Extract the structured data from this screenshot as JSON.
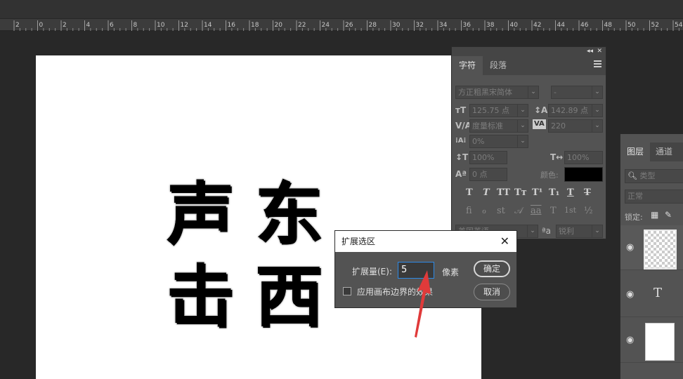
{
  "ruler": {
    "ticks": [
      "2",
      "0",
      "2",
      "4",
      "6",
      "8",
      "10",
      "12",
      "14",
      "16",
      "18",
      "20",
      "22",
      "24",
      "26",
      "28",
      "30",
      "32",
      "34",
      "36",
      "38",
      "40",
      "42",
      "44",
      "46",
      "48",
      "50",
      "52",
      "54"
    ]
  },
  "canvas": {
    "glyphs": [
      "声",
      "东",
      "击",
      "西"
    ]
  },
  "character_panel": {
    "tabs": [
      "字符",
      "段落"
    ],
    "font_family": "方正粗黑宋简体",
    "font_style": "-",
    "font_size": "125.75 点",
    "leading": "142.89 点",
    "kerning": "度量标准",
    "tracking": "220",
    "tsume": "0%",
    "vertical_scale": "100%",
    "horizontal_scale": "100%",
    "baseline_shift": "0 点",
    "color_label": "颜色:",
    "color_value": "#000000",
    "style_buttons": [
      "T",
      "T",
      "TT",
      "Tт",
      "T¹",
      "T₁",
      "T",
      "T"
    ],
    "opentype_buttons": [
      "fi",
      "ℴ",
      "st",
      "𝒜",
      "aa",
      "T",
      "1st",
      "½"
    ],
    "language": "美国英语",
    "aa_label": "ªa",
    "antialias": "锐利"
  },
  "layers_panel": {
    "tabs": [
      "图层",
      "通道"
    ],
    "search_placeholder": "类型",
    "blend_mode": "正常",
    "lock_label": "锁定:",
    "layer_text_glyph": "T"
  },
  "dialog": {
    "title": "扩展选区",
    "expand_label": "扩展量(E):",
    "expand_value": "5",
    "unit": "像素",
    "checkbox_label": "应用画布边界的效果",
    "ok_label": "确定",
    "cancel_label": "取消",
    "close_glyph": "✕"
  },
  "colors": {
    "accent_blue": "#2e8ae6",
    "annotation_red": "#e03a3a"
  }
}
